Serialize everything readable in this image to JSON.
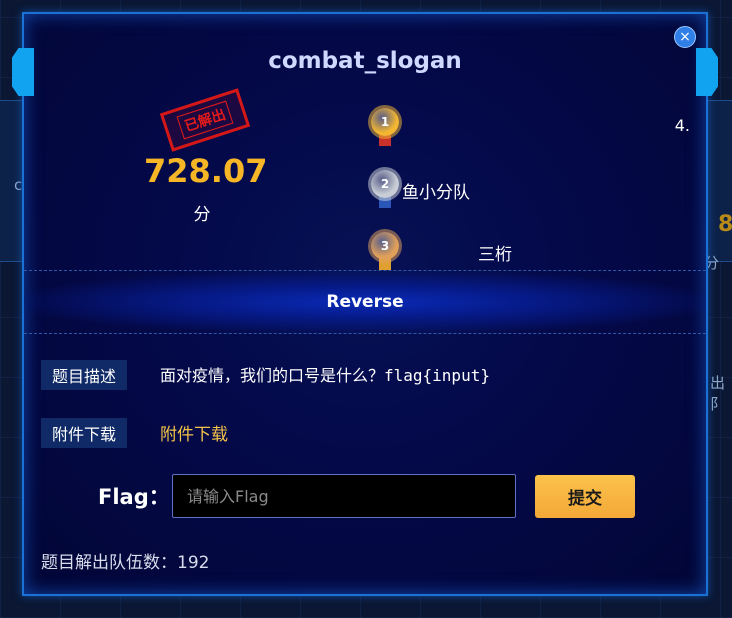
{
  "background": {
    "fragments": [
      {
        "text": "c"
      },
      {
        "text": "出阝"
      },
      {
        "text": "8"
      },
      {
        "text": "分"
      }
    ]
  },
  "modal": {
    "title": "combat_slogan",
    "close_glyph": "×",
    "stamp_text": "已解出",
    "points": "728.07",
    "points_unit": "分",
    "ranks": [
      {
        "place": "1",
        "name": "",
        "color": "#f2b632",
        "ribbon": "#c8322a"
      },
      {
        "place": "2",
        "name": "鱼小分队",
        "color": "#c9ced6",
        "ribbon": "#2a56b8"
      },
      {
        "place": "3",
        "name": "三桁",
        "color": "#e1a05a",
        "ribbon": "#e0a030"
      }
    ],
    "rank_extra": "4.",
    "category": "Reverse",
    "desc_label": "题目描述",
    "description": "面对疫情，我们的口号是什么？flag{input}",
    "attach_label": "附件下载",
    "attach_link": "附件下载",
    "flag_label": "Flag：",
    "flag_placeholder": "请输入Flag",
    "flag_value": "",
    "submit_label": "提交",
    "solve_count_text": "题目解出队伍数：192"
  },
  "colors": {
    "accent_gold": "#f7b626",
    "border_blue": "#1a72d6",
    "button_gold": "#fcc24a",
    "stamp_red": "#e11b1b"
  }
}
